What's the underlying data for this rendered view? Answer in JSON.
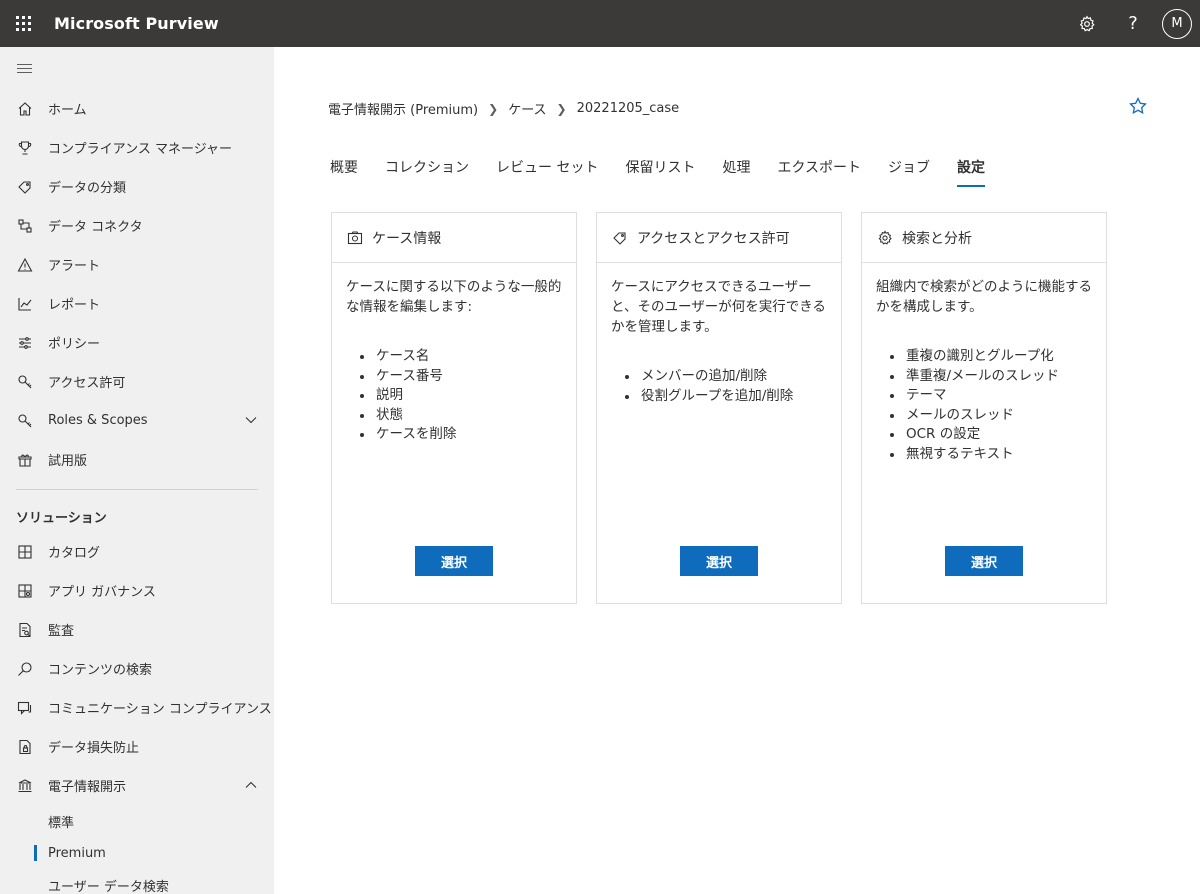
{
  "header": {
    "app_title": "Microsoft Purview",
    "avatar_initial": "M",
    "help_label": "?"
  },
  "sidebar": {
    "items": [
      {
        "label": "ホーム",
        "icon": "home-icon"
      },
      {
        "label": "コンプライアンス マネージャー",
        "icon": "trophy-icon"
      },
      {
        "label": "データの分類",
        "icon": "tag-icon"
      },
      {
        "label": "データ コネクタ",
        "icon": "connector-icon"
      },
      {
        "label": "アラート",
        "icon": "alert-icon"
      },
      {
        "label": "レポート",
        "icon": "chart-icon"
      },
      {
        "label": "ポリシー",
        "icon": "sliders-icon"
      },
      {
        "label": "アクセス許可",
        "icon": "key-icon"
      },
      {
        "label": "Roles & Scopes",
        "icon": "key-icon"
      },
      {
        "label": "試用版",
        "icon": "trial-icon"
      }
    ],
    "solutions_heading": "ソリューション",
    "solutions": [
      {
        "label": "カタログ",
        "icon": "catalog-icon"
      },
      {
        "label": "アプリ ガバナンス",
        "icon": "app-governance-icon"
      },
      {
        "label": "監査",
        "icon": "audit-icon"
      },
      {
        "label": "コンテンツの検索",
        "icon": "search-icon"
      },
      {
        "label": "コミュニケーション コンプライアンス",
        "icon": "communication-icon"
      },
      {
        "label": "データ損失防止",
        "icon": "dlp-icon"
      },
      {
        "label": "電子情報開示",
        "icon": "ediscovery-icon"
      }
    ],
    "ediscovery_sub": [
      "標準",
      "Premium",
      "ユーザー データ検索"
    ]
  },
  "breadcrumb": [
    "電子情報開示 (Premium)",
    "ケース",
    "20221205_case"
  ],
  "tabs": [
    "概要",
    "コレクション",
    "レビュー セット",
    "保留リスト",
    "処理",
    "エクスポート",
    "ジョブ",
    "設定"
  ],
  "active_tab": "設定",
  "cards": [
    {
      "title": "ケース情報",
      "icon": "camera-icon",
      "description": "ケースに関する以下のような一般的な情報を編集します:",
      "items": [
        "ケース名",
        "ケース番号",
        "説明",
        "状態",
        "ケースを削除"
      ],
      "button": "選択"
    },
    {
      "title": "アクセスとアクセス許可",
      "icon": "tag-icon",
      "description": "ケースにアクセスできるユーザーと、そのユーザーが何を実行できるかを管理します。",
      "items": [
        "メンバーの追加/削除",
        "役割グループを追加/削除"
      ],
      "button": "選択"
    },
    {
      "title": "検索と分析",
      "icon": "gear-icon",
      "description": "組織内で検索がどのように機能するかを構成します。",
      "items": [
        "重複の識別とグループ化",
        "準重複/メールのスレッド",
        "テーマ",
        "メールのスレッド",
        "OCR の設定",
        "無視するテキスト"
      ],
      "button": "選択"
    }
  ]
}
